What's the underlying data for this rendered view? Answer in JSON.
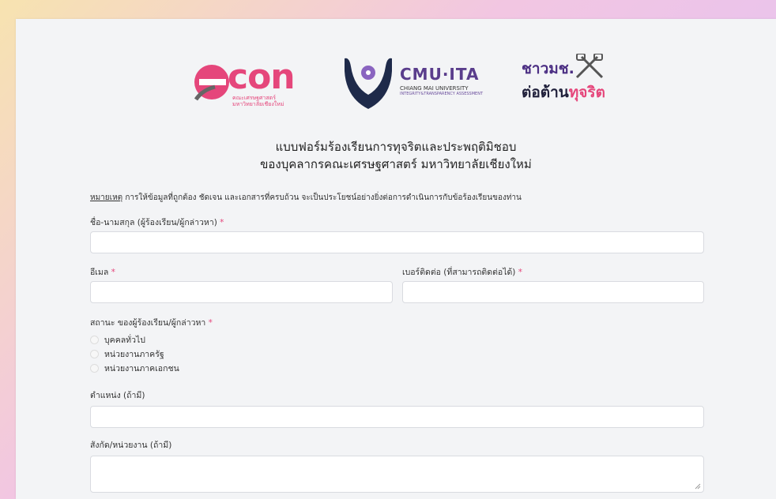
{
  "logos": {
    "econ": {
      "word": "con",
      "sub1": "คณะเศรษฐศาสตร์",
      "sub2": "มหาวิทยาลัยเชียงใหม่"
    },
    "cmu": {
      "title": "CMU·ITA",
      "sub": "CHIANG MAI UNIVERSITY",
      "sub2": "INTEGRITY&TRANSPARENCY ASSESSMENT"
    },
    "anti": {
      "top": "ชาวมช.",
      "bottom_a": "ต่อต้าน",
      "bottom_b": "ทุจริต"
    }
  },
  "form": {
    "title_line1": "แบบฟอร์มร้องเรียนการทุจริตและประพฤติมิชอบ",
    "title_line2": "ของบุคลากรคณะเศรษฐศาสตร์ มหาวิทยาลัยเชียงใหม่",
    "note_label": "หมายเหตุ",
    "note_text": " การให้ข้อมูลที่ถูกต้อง ชัดเจน และเอกสารที่ครบถ้วน จะเป็นประโยชน์อย่างยิ่งต่อการดำเนินการกับข้อร้องเรียนของท่าน",
    "fields": {
      "name_label": "ชื่อ-นามสกุล (ผู้ร้องเรียน/ผู้กล่าวหา)",
      "email_label": "อีเมล",
      "phone_label": "เบอร์ติดต่อ (ที่สามารถติดต่อได้)",
      "status_label": "สถานะ ของผู้ร้องเรียน/ผู้กล่าวหา",
      "position_label": "ตำแหน่ง (ถ้ามี)",
      "affiliation_label": "สังกัด/หน่วยงาน (ถ้ามี)",
      "required_mark": "*"
    },
    "status_options": [
      "บุคคลทั่วไป",
      "หน่วยงานภาครัฐ",
      "หน่วยงานภาคเอกชน"
    ]
  },
  "colors": {
    "accent": "#e5467b",
    "cmu_purple": "#5a3d8c"
  }
}
